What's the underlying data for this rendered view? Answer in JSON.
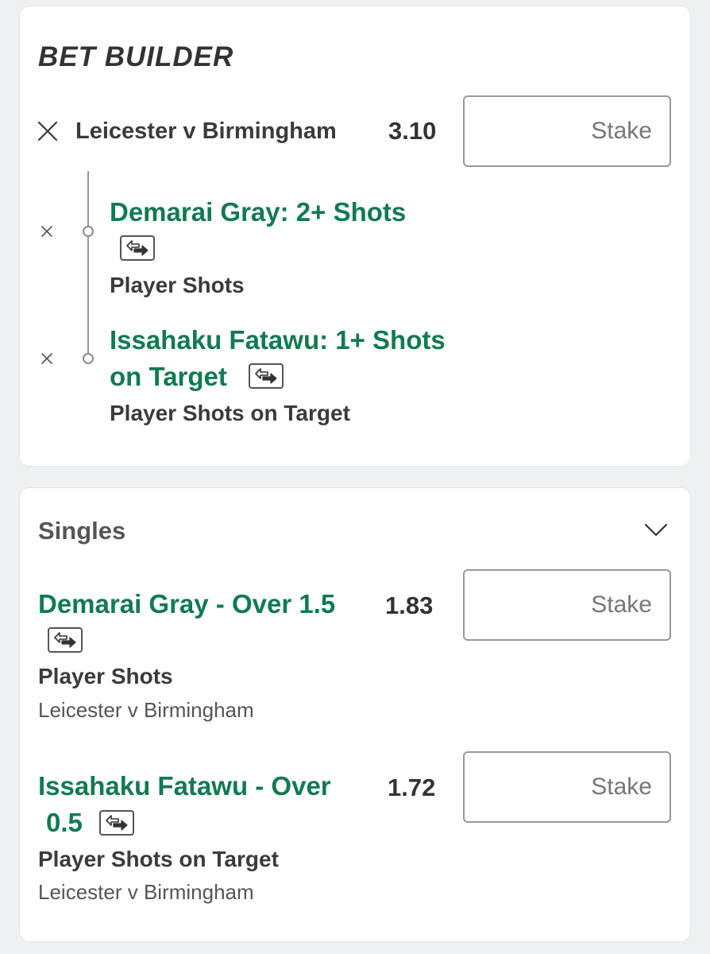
{
  "bet_builder": {
    "title": "BET BUILDER",
    "event": "Leicester v Birmingham",
    "odds": "3.10",
    "stake_placeholder": "Stake",
    "legs": [
      {
        "title": "Demarai Gray: 2+ Shots",
        "market": "Player Shots"
      },
      {
        "title_line1": "Issahaku Fatawu: 1+ Shots",
        "title_line2": "on Target",
        "market": "Player Shots on Target"
      }
    ]
  },
  "singles": {
    "heading": "Singles",
    "items": [
      {
        "title": "Demarai Gray - Over 1.5",
        "odds": "1.83",
        "market": "Player Shots",
        "event": "Leicester v Birmingham",
        "stake_placeholder": "Stake"
      },
      {
        "title_line1": "Issahaku Fatawu - Over",
        "title_line2": "0.5",
        "odds": "1.72",
        "market": "Player Shots on Target",
        "event": "Leicester v Birmingham",
        "stake_placeholder": "Stake"
      }
    ]
  },
  "icons": {
    "remove": "close-icon",
    "swap": "swap-icon",
    "collapse": "chevron-down-icon"
  },
  "colors": {
    "selection_green": "#127a50",
    "text_dark": "#333333",
    "background": "#eef0f2",
    "card": "#ffffff"
  }
}
